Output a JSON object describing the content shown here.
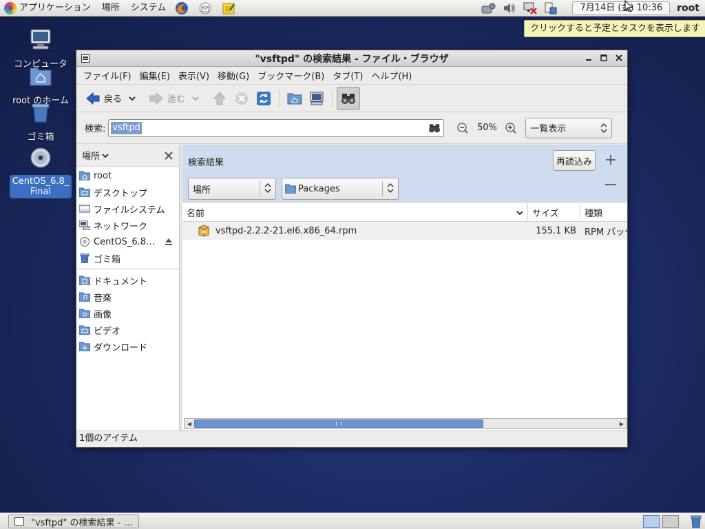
{
  "top_panel": {
    "menus": [
      "アプリケーション",
      "場所",
      "システム"
    ],
    "launchers": [
      "firefox-icon",
      "mail-icon",
      "notes-icon"
    ],
    "tray_icons": [
      "network-icon",
      "volume-icon",
      "network-disconnected-icon",
      "update-icon"
    ],
    "clock": "7月14日 (金) 10:36",
    "user": "root"
  },
  "tooltip": "クリックすると予定とタスクを表示します",
  "desktop_icons": [
    {
      "label": "コンピュータ",
      "icon": "computer-icon"
    },
    {
      "label": "root のホーム",
      "icon": "home-folder-icon"
    },
    {
      "label": "ゴミ箱",
      "icon": "trash-icon"
    },
    {
      "label": "CentOS_6.8_ Final",
      "icon": "disc-icon"
    }
  ],
  "window": {
    "title": "\"vsftpd\" の検索結果 - ファイル・ブラウザ",
    "menubar": [
      "ファイル(F)",
      "編集(E)",
      "表示(V)",
      "移動(G)",
      "ブックマーク(B)",
      "タブ(T)",
      "ヘルプ(H)"
    ],
    "toolbar": {
      "back_label": "戻る",
      "forward_label": "進む"
    },
    "search": {
      "label": "検索:",
      "value": "vsftpd"
    },
    "zoom_level": "50%",
    "view_mode": "一覧表示",
    "sidebar": {
      "header": "場所",
      "places": [
        {
          "label": "root",
          "icon": "home-folder-icon"
        },
        {
          "label": "デスクトップ",
          "icon": "desktop-folder-icon"
        },
        {
          "label": "ファイルシステム",
          "icon": "drive-icon"
        },
        {
          "label": "ネットワーク",
          "icon": "network-icon"
        },
        {
          "label": "CentOS_6.8…",
          "icon": "disc-icon"
        },
        {
          "label": "ゴミ箱",
          "icon": "trash-icon"
        }
      ],
      "bookmarks": [
        {
          "label": "ドキュメント",
          "icon": "documents-folder-icon"
        },
        {
          "label": "音楽",
          "icon": "music-folder-icon"
        },
        {
          "label": "画像",
          "icon": "pictures-folder-icon"
        },
        {
          "label": "ビデオ",
          "icon": "videos-folder-icon"
        },
        {
          "label": "ダウンロード",
          "icon": "downloads-folder-icon"
        }
      ]
    },
    "results": {
      "title": "検索結果",
      "reload_label": "再読込み",
      "location_combo": "場所",
      "folder_combo": "Packages"
    },
    "columns": {
      "name": "名前",
      "size": "サイズ",
      "type": "種類"
    },
    "files": [
      {
        "name": "vsftpd-2.2.2-21.el6.x86_64.rpm",
        "size": "155.1 KB",
        "type": "RPM パッケージ"
      }
    ],
    "status": "1個のアイテム"
  },
  "taskbar": {
    "task_label": "\"vsftpd\" の検索結果 - …"
  }
}
